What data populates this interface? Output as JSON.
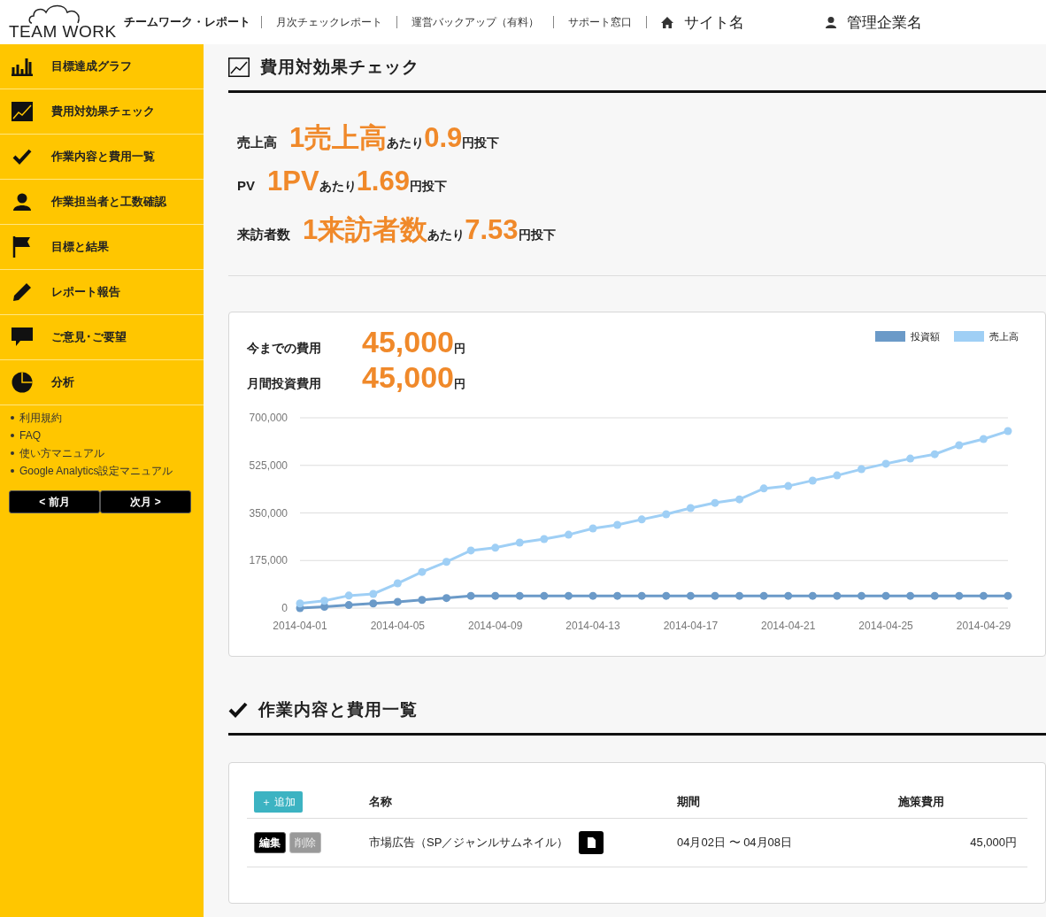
{
  "header": {
    "logo": "TEAM WORK",
    "brand": "チームワーク・レポート",
    "links": [
      "月次チェックレポート",
      "運営バックアップ（有料）",
      "サポート窓口"
    ],
    "site": "サイト名",
    "company": "管理企業名"
  },
  "sidebar": {
    "items": [
      {
        "kind": "bars",
        "label": "目標達成グラフ"
      },
      {
        "kind": "trend",
        "label": "費用対効果チェック"
      },
      {
        "kind": "check",
        "label": "作業内容と費用一覧"
      },
      {
        "kind": "person",
        "label": "作業担当者と工数確認"
      },
      {
        "kind": "flag",
        "label": "目標と結果"
      },
      {
        "kind": "pencil",
        "label": "レポート報告"
      },
      {
        "kind": "comment",
        "label": "ご意見･ご要望"
      },
      {
        "kind": "pie",
        "label": "分析"
      }
    ],
    "links": [
      "利用規約",
      "FAQ",
      "使い方マニュアル",
      "Google Analytics設定マニュアル"
    ],
    "prev": "< 前月",
    "next": "次月 >"
  },
  "section1": {
    "title": "費用対効果チェック",
    "metrics": [
      {
        "label": "売上高",
        "unit": "1売上高",
        "per": "あたり",
        "value": "0.9",
        "suffix": "円投下"
      },
      {
        "label": "PV",
        "unit": "1PV",
        "per": "あたり",
        "value": "1.69",
        "suffix": "円投下"
      },
      {
        "label": "来訪者数",
        "unit": "1来訪者数",
        "per": "あたり",
        "value": "7.53",
        "suffix": "円投下"
      }
    ]
  },
  "costs": {
    "rows": [
      {
        "label": "今までの費用",
        "value": "45,000",
        "unit": "円"
      },
      {
        "label": "月間投資費用",
        "value": "45,000",
        "unit": "円"
      }
    ],
    "chart_data": {
      "type": "line",
      "x": [
        "2014-04-01",
        "2014-04-02",
        "2014-04-03",
        "2014-04-04",
        "2014-04-05",
        "2014-04-06",
        "2014-04-07",
        "2014-04-08",
        "2014-04-09",
        "2014-04-10",
        "2014-04-11",
        "2014-04-12",
        "2014-04-13",
        "2014-04-14",
        "2014-04-15",
        "2014-04-16",
        "2014-04-17",
        "2014-04-18",
        "2014-04-19",
        "2014-04-20",
        "2014-04-21",
        "2014-04-22",
        "2014-04-23",
        "2014-04-24",
        "2014-04-25",
        "2014-04-26",
        "2014-04-27",
        "2014-04-28",
        "2014-04-29",
        "2014-04-30"
      ],
      "xlim": [
        "2014-04-01",
        "2014-04-30"
      ],
      "ylim": [
        0,
        700000
      ],
      "grid": true,
      "yticks": [
        {
          "value": 0,
          "label": "0"
        },
        {
          "value": 175000,
          "label": "175,000"
        },
        {
          "value": 350000,
          "label": "350,000"
        },
        {
          "value": 525000,
          "label": "525,000"
        },
        {
          "value": 700000,
          "label": "700,000"
        }
      ],
      "xticks": [
        "2014-04-01",
        "2014-04-05",
        "2014-04-09",
        "2014-04-13",
        "2014-04-17",
        "2014-04-21",
        "2014-04-25",
        "2014-04-29"
      ],
      "series": [
        {
          "name": "投資額",
          "color": "#6b9ac8",
          "marker": "circle",
          "values": [
            0,
            5000,
            11000,
            17000,
            23000,
            30000,
            37000,
            45000,
            45000,
            45000,
            45000,
            45000,
            45000,
            45000,
            45000,
            45000,
            45000,
            45000,
            45000,
            45000,
            45000,
            45000,
            45000,
            45000,
            45000,
            45000,
            45000,
            45000,
            45000,
            45000
          ]
        },
        {
          "name": "売上高",
          "color": "#9fcff5",
          "marker": "circle",
          "values": [
            17000,
            27000,
            46000,
            52000,
            91000,
            133000,
            170000,
            212000,
            222000,
            241000,
            254000,
            270000,
            293000,
            306000,
            326000,
            345000,
            368000,
            387000,
            400000,
            440000,
            449000,
            469000,
            488000,
            511000,
            531000,
            550000,
            566000,
            599000,
            622000,
            651000
          ]
        }
      ]
    }
  },
  "section2": {
    "title": "作業内容と費用一覧",
    "add": "＋ 追加",
    "columns": [
      "名称",
      "期間",
      "施策費用"
    ],
    "rows": [
      {
        "edit": "編集",
        "delete": "削除",
        "name": "市場広告（SP／ジャンルサムネイル）",
        "period": "04月02日 〜 04月08日",
        "cost": "45,000円"
      }
    ]
  }
}
